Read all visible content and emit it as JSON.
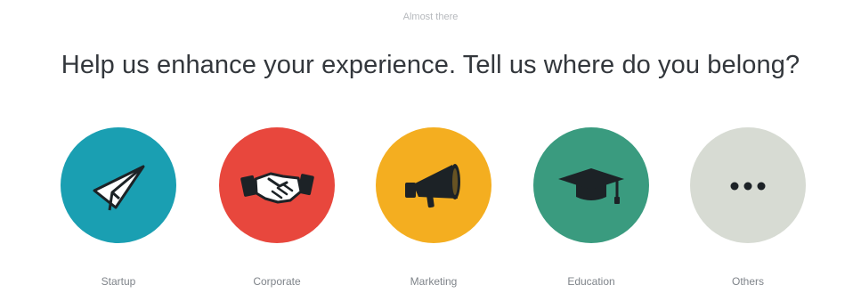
{
  "header": {
    "step_label": "Almost there",
    "headline": "Help us enhance your experience. Tell us where do you belong?"
  },
  "options": [
    {
      "label": "Startup",
      "icon": "paper-plane-icon",
      "color": "#1a9fb2"
    },
    {
      "label": "Corporate",
      "icon": "handshake-icon",
      "color": "#e8473d"
    },
    {
      "label": "Marketing",
      "icon": "megaphone-icon",
      "color": "#f4ae20"
    },
    {
      "label": "Education",
      "icon": "graduation-cap-icon",
      "color": "#3a9b7f"
    },
    {
      "label": "Others",
      "icon": "ellipsis-icon",
      "color": "#d7dbd3"
    }
  ]
}
